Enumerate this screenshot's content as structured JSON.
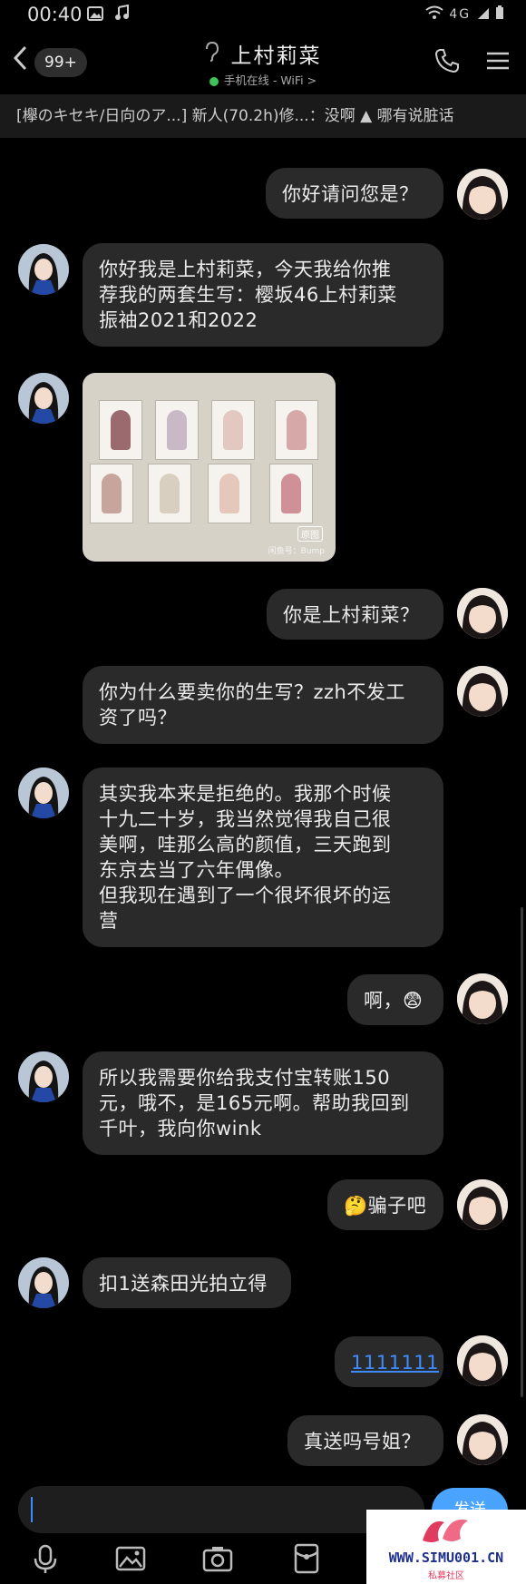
{
  "status_bar": {
    "time": "00:40",
    "icons": [
      "image-icon",
      "music-icon"
    ],
    "right": "4G"
  },
  "header": {
    "unread": "99+",
    "contact_name": "上村莉菜",
    "online": "手机在线 - WiFi >"
  },
  "notice": "[欅のキセキ/日向のア...] 新人(70.2h)修...：没啊 ▲ 哪有说脏话",
  "messages": [
    {
      "side": "right",
      "text": "你好请问您是？"
    },
    {
      "side": "left",
      "text": "你好我是上村莉菜，今天我给你推\n荐我的两套生写：樱坂46上村莉菜\n振袖2021和2022"
    },
    {
      "side": "left",
      "type": "image",
      "badge": "原图",
      "watermark": "闲鱼号：Bump"
    },
    {
      "side": "right",
      "text": "你是上村莉菜？"
    },
    {
      "side": "right",
      "text": "你为什么要卖你的生写？zzh不发工\n资了吗？"
    },
    {
      "side": "left",
      "text": "其实我本来是拒绝的。我那个时候\n十九二十岁，我当然觉得我自己很\n美啊，哇那么高的颜值，三天跑到\n东京去当了六年偶像。\n但我现在遇到了一个很坏很坏的运\n营"
    },
    {
      "side": "right",
      "text": "啊，😨"
    },
    {
      "side": "left",
      "text": "所以我需要你给我支付宝转账150\n元，哦不，是165元啊。帮助我回到\n千叶，我向你wink"
    },
    {
      "side": "right",
      "text": "🤔骗子吧"
    },
    {
      "side": "left",
      "text": "扣1送森田光拍立得"
    },
    {
      "side": "right",
      "text": "1111111",
      "link": true
    },
    {
      "side": "right",
      "text": "真送吗号姐？"
    }
  ],
  "input": {
    "placeholder": ""
  },
  "send_label": "发送",
  "watermark": {
    "site": "WWW.SIMU001.CN",
    "sub": "私募社区"
  },
  "colors": {
    "bubble": "#2a2a2a",
    "link": "#3d8cff",
    "online": "#3cc45a",
    "send": "#4aa3ff"
  }
}
